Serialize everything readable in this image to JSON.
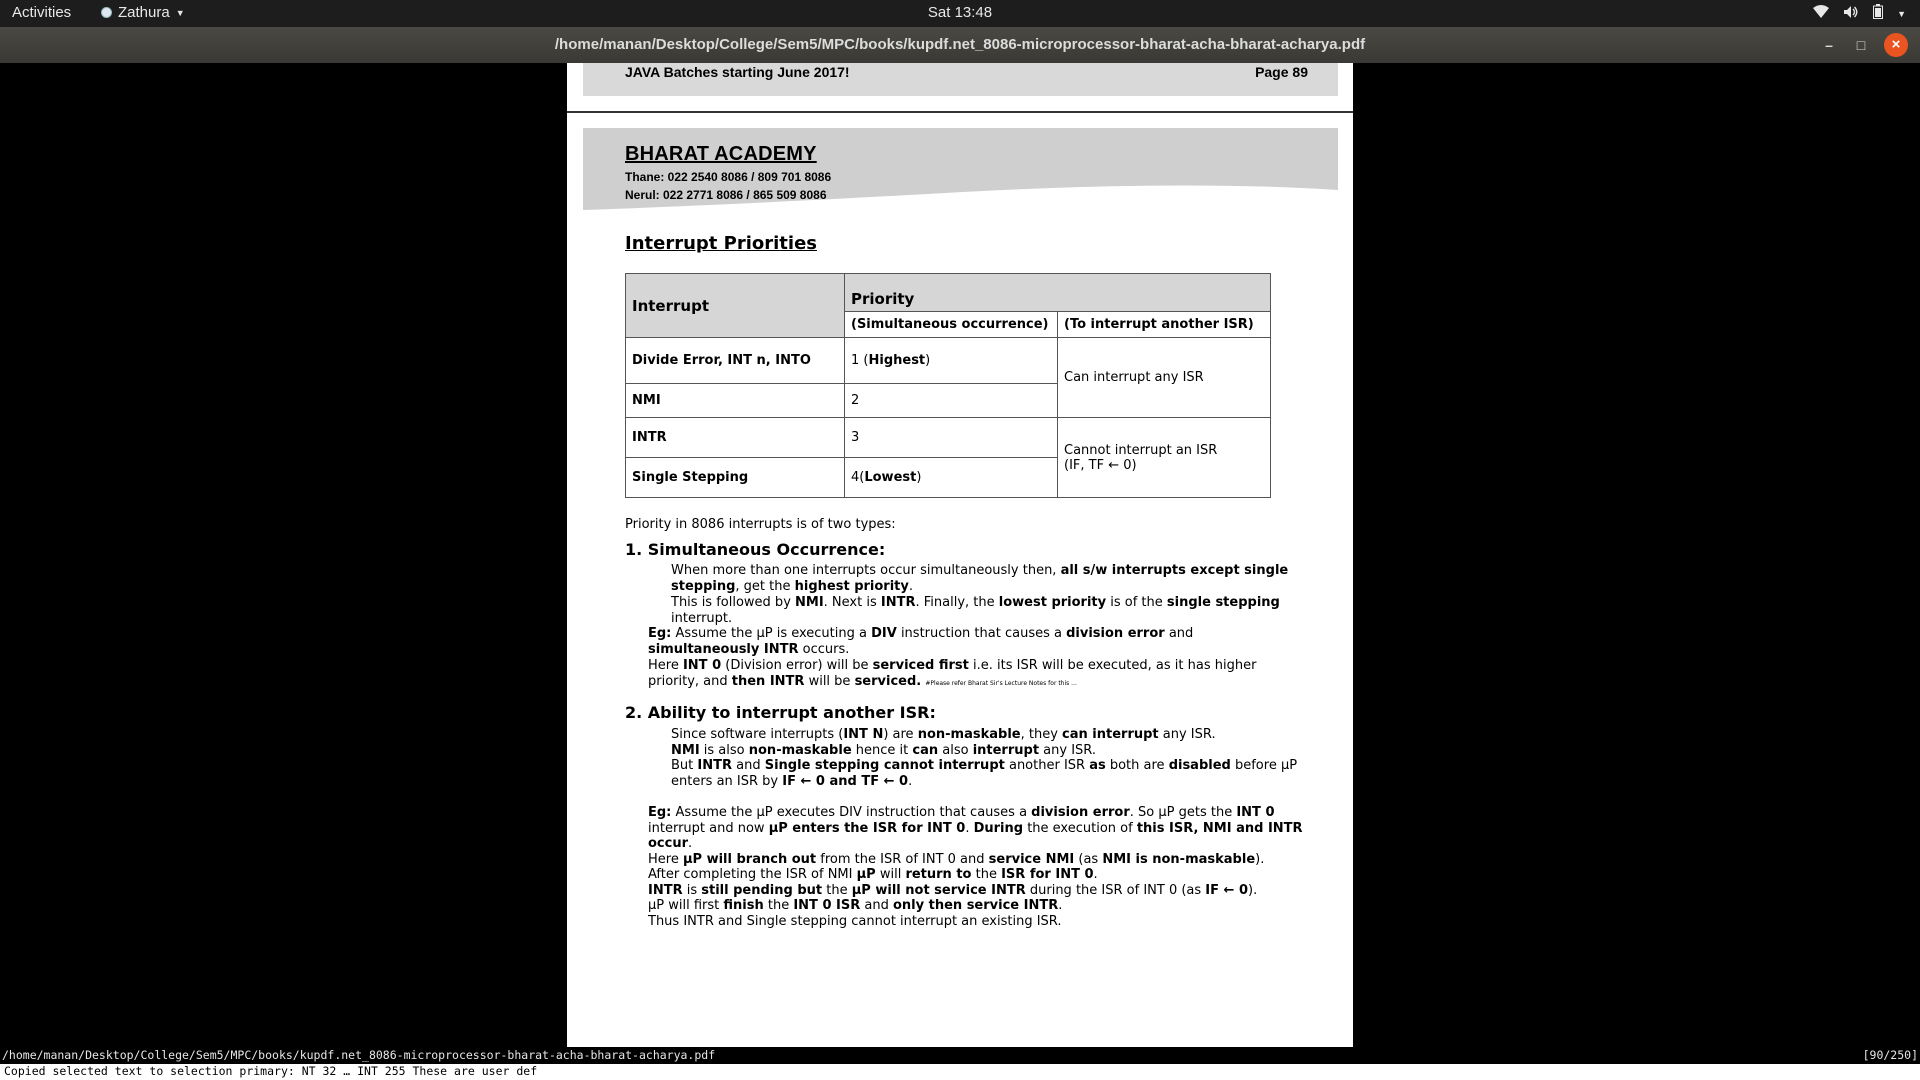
{
  "topbar": {
    "activities": "Activities",
    "app_name": "Zathura",
    "clock": "Sat 13:48"
  },
  "window": {
    "title": "/home/manan/Desktop/College/Sem5/MPC/books/kupdf.net_8086-microprocessor-bharat-acha-bharat-acharya.pdf",
    "close_glyph": "×",
    "maximize_glyph": "□",
    "minimize_glyph": "–"
  },
  "prev_footer": {
    "left": "JAVA Batches starting  June 2017!",
    "right": "Page 89"
  },
  "banner": {
    "academy": "BHARAT ACADEMY",
    "thane": "Thane: 022 2540 8086 / 809 701 8086",
    "nerul": "Nerul: 022 2771 8086 / 865 509 8086"
  },
  "section_title": "Interrupt Priorities",
  "table": {
    "col_interrupt": "Interrupt",
    "col_priority": "Priority",
    "sub_simul": "(Simultaneous occurrence)",
    "sub_isr": "(To interrupt another ISR)",
    "rows": [
      {
        "name": "Divide Error, INT n, INTO",
        "num": "1 (",
        "tag": "Highest",
        "end": ")"
      },
      {
        "name": "NMI",
        "num": "2",
        "tag": "",
        "end": ""
      },
      {
        "name": "INTR",
        "num": "3",
        "tag": "",
        "end": ""
      },
      {
        "name": "Single Stepping",
        "num": "4(",
        "tag": "Lowest",
        "end": ")"
      }
    ],
    "isr_can": "Can interrupt any ISR",
    "isr_cannot_1": "Cannot interrupt an ISR",
    "isr_cannot_2": "(IF, TF ← 0)"
  },
  "intro": "Priority in 8086 interrupts is of two types:",
  "s1": {
    "heading": "1. Simultaneous Occurrence:",
    "p1a": "When more than one interrupts occur simultaneously then, ",
    "p1b": "all s/w interrupts except single stepping",
    "p1c": ", get the ",
    "p1d": "highest priority",
    "p1e": ".",
    "p2a": "This is followed by ",
    "p2b": "NMI",
    "p2c": ". Next is ",
    "p2d": "INTR",
    "p2e": ". Finally, the ",
    "p2f": "lowest priority",
    "p2g": " is of the ",
    "p2h": "single stepping",
    "p2i": " interrupt.",
    "eg_a": "Eg:",
    "eg_b": " Assume the μP is executing a ",
    "eg_c": "DIV",
    "eg_d": " instruction that causes a ",
    "eg_e": "division error",
    "eg_f": " and ",
    "eg_g": "simultaneously INTR",
    "eg_h": " occurs.",
    "h_a": "Here ",
    "h_b": "INT 0",
    "h_c": " (Division error) will be ",
    "h_d": "serviced first",
    "h_e": " i.e. its ISR will be executed, as it has higher priority, and ",
    "h_f": "then INTR",
    "h_g": " will be ",
    "h_h": "serviced.",
    "h_note": "#Please refer Bharat Sir's Lecture Notes for  this ..."
  },
  "s2": {
    "heading": "2. Ability to interrupt another ISR:",
    "l1a": "Since software interrupts (",
    "l1b": "INT N",
    "l1c": ") are ",
    "l1d": "non-maskable",
    "l1e": ", they ",
    "l1f": "can interrupt",
    "l1g": " any ISR.",
    "l2a": "NMI",
    "l2b": " is also ",
    "l2c": "non-maskable",
    "l2d": " hence it ",
    "l2e": "can",
    "l2f": " also ",
    "l2g": "interrupt",
    "l2h": " any ISR.",
    "l3a": "But ",
    "l3b": "INTR",
    "l3c": " and ",
    "l3d": "Single stepping cannot interrupt",
    "l3e": " another ISR ",
    "l3f": "as",
    "l3g": " both are ",
    "l3h": "disabled",
    "l3i": " before μP enters an ISR by ",
    "l3j": "IF ← 0 and TF ← 0",
    "l3k": ".",
    "e1a": "Eg:",
    "e1b": " Assume the μP executes DIV instruction that causes a ",
    "e1c": "division error",
    "e1d": ". So μP gets the ",
    "e1e": "INT 0",
    "e1f": " interrupt and now ",
    "e1g": "μP enters the ISR for INT 0",
    "e1h": ". ",
    "e1i": "During",
    "e1j": " the execution of ",
    "e1k": "this ISR, NMI and INTR occur",
    "e1l": ".",
    "e2a": "Here ",
    "e2b": "μP will branch out",
    "e2c": " from the ISR of INT 0 and ",
    "e2d": "service NMI",
    "e2e": " (as ",
    "e2f": "NMI is non-maskable",
    "e2g": ").",
    "e3a": "After completing the ISR of NMI ",
    "e3b": "μP",
    "e3c": " will ",
    "e3d": "return to",
    "e3e": " the ",
    "e3f": "ISR for INT 0",
    "e3g": ".",
    "e4a": "INTR",
    "e4b": " is ",
    "e4c": "still pending but",
    "e4d": " the ",
    "e4e": "μP will not service INTR",
    "e4f": " during the ISR of INT 0 (as ",
    "e4g": "IF ← 0",
    "e4h": ").",
    "e5a": "μP will first ",
    "e5b": "finish",
    "e5c": " the ",
    "e5d": "INT 0 ISR",
    "e5e": " and ",
    "e5f": "only then service INTR",
    "e5g": ".",
    "e6": "Thus INTR and Single stepping cannot interrupt an existing ISR."
  },
  "statusbar": {
    "path": "/home/manan/Desktop/College/Sem5/MPC/books/kupdf.net_8086-microprocessor-bharat-acha-bharat-acharya.pdf",
    "page_count": "[90/250]",
    "message": "Copied selected text to selection primary: NT 32 … INT 255 These are user def"
  }
}
